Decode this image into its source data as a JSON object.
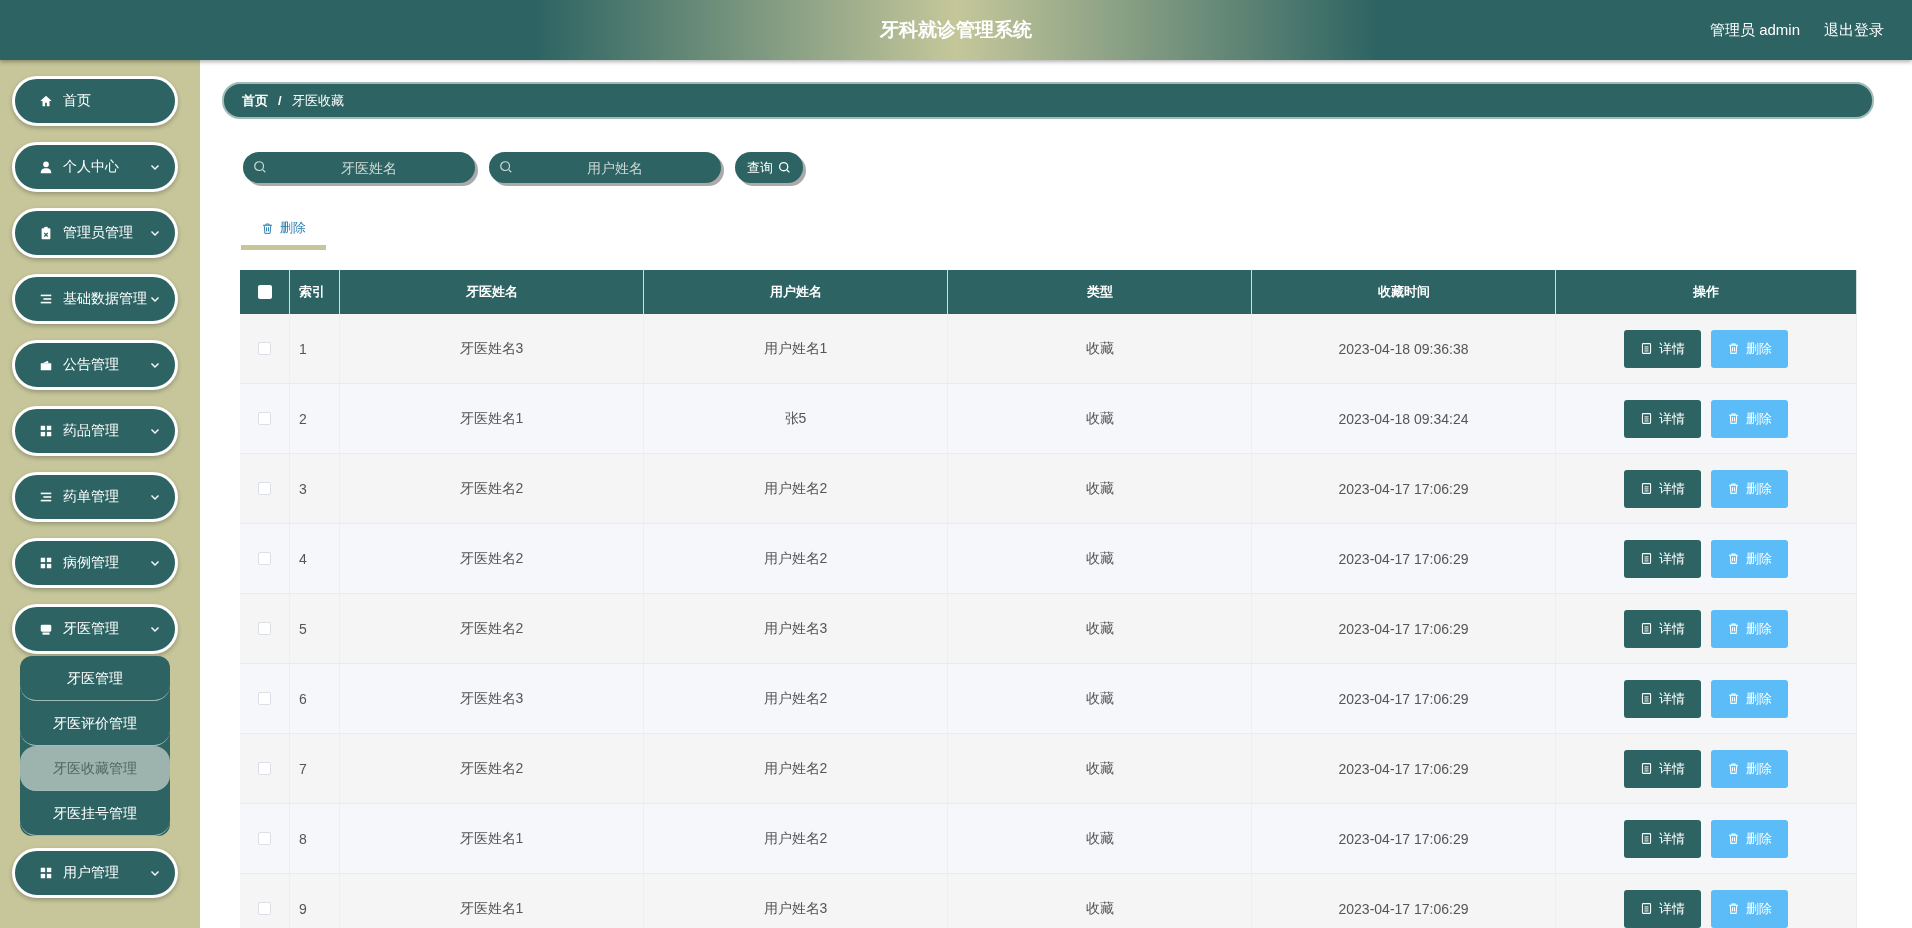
{
  "header": {
    "title": "牙科就诊管理系统",
    "user": "管理员 admin",
    "logout": "退出登录"
  },
  "sidebar": {
    "items": [
      {
        "label": "首页",
        "kind": "home",
        "has_arrow": false
      },
      {
        "label": "个人中心",
        "kind": "user",
        "has_arrow": true
      },
      {
        "label": "管理员管理",
        "kind": "clipboard",
        "has_arrow": true
      },
      {
        "label": "基础数据管理",
        "kind": "list",
        "has_arrow": true
      },
      {
        "label": "公告管理",
        "kind": "wallet",
        "has_arrow": true
      },
      {
        "label": "药品管理",
        "kind": "grid",
        "has_arrow": true
      },
      {
        "label": "药单管理",
        "kind": "list",
        "has_arrow": true
      },
      {
        "label": "病例管理",
        "kind": "grid",
        "has_arrow": true
      },
      {
        "label": "牙医管理",
        "kind": "tray",
        "has_arrow": true,
        "children": [
          {
            "label": "牙医管理",
            "selected": false
          },
          {
            "label": "牙医评价管理",
            "selected": false
          },
          {
            "label": "牙医收藏管理",
            "selected": true
          },
          {
            "label": "牙医挂号管理",
            "selected": false
          }
        ]
      },
      {
        "label": "用户管理",
        "kind": "grid",
        "has_arrow": true
      }
    ]
  },
  "breadcrumb": {
    "items": [
      "首页",
      "牙医收藏"
    ],
    "separator": "/"
  },
  "search": {
    "fields": [
      {
        "placeholder": "牙医姓名"
      },
      {
        "placeholder": "用户姓名"
      }
    ],
    "button": "查询"
  },
  "toolbar": {
    "tabs": [
      {
        "label": "删除",
        "selected": true
      }
    ]
  },
  "table": {
    "all_checked": false,
    "columns": [
      "索引",
      "牙医姓名",
      "用户姓名",
      "类型",
      "收藏时间",
      "操作"
    ],
    "rows": [
      {
        "checked": false,
        "cells": [
          "1",
          "牙医姓名3",
          "用户姓名1",
          "收藏",
          "2023-04-18 09:36:38"
        ],
        "actions": [
          {
            "kind": "detail",
            "label": "详情"
          },
          {
            "kind": "delete",
            "label": "删除"
          }
        ]
      },
      {
        "checked": false,
        "cells": [
          "2",
          "牙医姓名1",
          "张5",
          "收藏",
          "2023-04-18 09:34:24"
        ],
        "actions": [
          {
            "kind": "detail",
            "label": "详情"
          },
          {
            "kind": "delete",
            "label": "删除"
          }
        ]
      },
      {
        "checked": false,
        "cells": [
          "3",
          "牙医姓名2",
          "用户姓名2",
          "收藏",
          "2023-04-17 17:06:29"
        ],
        "actions": [
          {
            "kind": "detail",
            "label": "详情"
          },
          {
            "kind": "delete",
            "label": "删除"
          }
        ]
      },
      {
        "checked": false,
        "cells": [
          "4",
          "牙医姓名2",
          "用户姓名2",
          "收藏",
          "2023-04-17 17:06:29"
        ],
        "actions": [
          {
            "kind": "detail",
            "label": "详情"
          },
          {
            "kind": "delete",
            "label": "删除"
          }
        ]
      },
      {
        "checked": false,
        "cells": [
          "5",
          "牙医姓名2",
          "用户姓名3",
          "收藏",
          "2023-04-17 17:06:29"
        ],
        "actions": [
          {
            "kind": "detail",
            "label": "详情"
          },
          {
            "kind": "delete",
            "label": "删除"
          }
        ]
      },
      {
        "checked": false,
        "cells": [
          "6",
          "牙医姓名3",
          "用户姓名2",
          "收藏",
          "2023-04-17 17:06:29"
        ],
        "actions": [
          {
            "kind": "detail",
            "label": "详情"
          },
          {
            "kind": "delete",
            "label": "删除"
          }
        ]
      },
      {
        "checked": false,
        "cells": [
          "7",
          "牙医姓名2",
          "用户姓名2",
          "收藏",
          "2023-04-17 17:06:29"
        ],
        "actions": [
          {
            "kind": "detail",
            "label": "详情"
          },
          {
            "kind": "delete",
            "label": "删除"
          }
        ]
      },
      {
        "checked": false,
        "cells": [
          "8",
          "牙医姓名1",
          "用户姓名2",
          "收藏",
          "2023-04-17 17:06:29"
        ],
        "actions": [
          {
            "kind": "detail",
            "label": "详情"
          },
          {
            "kind": "delete",
            "label": "删除"
          }
        ]
      },
      {
        "checked": false,
        "cells": [
          "9",
          "牙医姓名1",
          "用户姓名3",
          "收藏",
          "2023-04-17 17:06:29"
        ],
        "actions": [
          {
            "kind": "detail",
            "label": "详情"
          },
          {
            "kind": "delete",
            "label": "删除"
          }
        ]
      }
    ]
  }
}
